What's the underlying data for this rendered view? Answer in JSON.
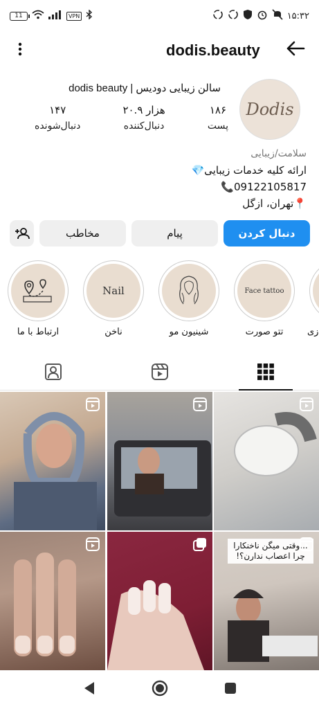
{
  "status_bar": {
    "time": "۱۵:۳۲",
    "battery": "11",
    "vpn": "VPN",
    "left_icons": [
      "battery-icon",
      "wifi-icon",
      "signal-icon",
      "vpn-badge",
      "bluetooth-icon"
    ],
    "right_icons": [
      "sync-icon",
      "sync-icon",
      "shield-icon",
      "alarm-icon",
      "mute-icon"
    ]
  },
  "header": {
    "username": "dodis.beauty",
    "back_icon": "back-arrow-icon",
    "menu_icon": "more-vertical-icon"
  },
  "profile": {
    "avatar_text": "Dodis",
    "full_name": "سالن زیبایی دودیس | dodis beauty",
    "stats": [
      {
        "value": "۱۸۶",
        "label": "پست"
      },
      {
        "value": "۲۰.۹ هزار",
        "label": "دنبال‌کننده"
      },
      {
        "value": "۱۴۷",
        "label": "دنبال‌شونده"
      }
    ],
    "category": "سلامت/زیبایی",
    "bio_line1": "ارائه کلیه خدمات زیبایی💎",
    "bio_line2": "09122105817📞",
    "bio_line3": "📍تهران، ازگل"
  },
  "actions": {
    "follow": "دنبال کردن",
    "message": "پیام",
    "contact": "مخاطب",
    "add_user_icon": "add-user-icon"
  },
  "highlights": [
    {
      "label": "ارتباط با ما",
      "inner": "map-pin-icon"
    },
    {
      "label": "ناخن",
      "inner": "Nail"
    },
    {
      "label": "شینیون مو",
      "inner": "hair-sketch"
    },
    {
      "label": "تتو صورت",
      "inner": "Face tattoo"
    },
    {
      "label": "زی",
      "inner": ""
    }
  ],
  "tabs": [
    {
      "name": "tagged",
      "icon": "tagged-person-icon"
    },
    {
      "name": "reels",
      "icon": "reels-icon"
    },
    {
      "name": "grid",
      "icon": "grid-icon"
    }
  ],
  "posts": [
    {
      "kind": "reel",
      "caption": "",
      "colors": [
        "#c9b7a6",
        "#5e6c83"
      ]
    },
    {
      "kind": "reel",
      "caption": "",
      "colors": [
        "#8b8f96",
        "#4a3b36"
      ]
    },
    {
      "kind": "reel",
      "caption": "",
      "colors": [
        "#d8d6d3",
        "#9aa0a6"
      ]
    },
    {
      "kind": "reel",
      "caption": "",
      "colors": [
        "#b59888",
        "#6e4f42"
      ]
    },
    {
      "kind": "multi",
      "caption": "",
      "colors": [
        "#7e1e34",
        "#e8c9bd"
      ]
    },
    {
      "kind": "reel",
      "caption": "...وقتی میگن ناخنکارا چرا اعصاب ندارن؟!",
      "colors": [
        "#cfc6be",
        "#3a3535"
      ]
    }
  ],
  "navbar": {
    "back": "nav-back-icon",
    "home": "nav-home-icon",
    "recent": "nav-recent-icon"
  }
}
